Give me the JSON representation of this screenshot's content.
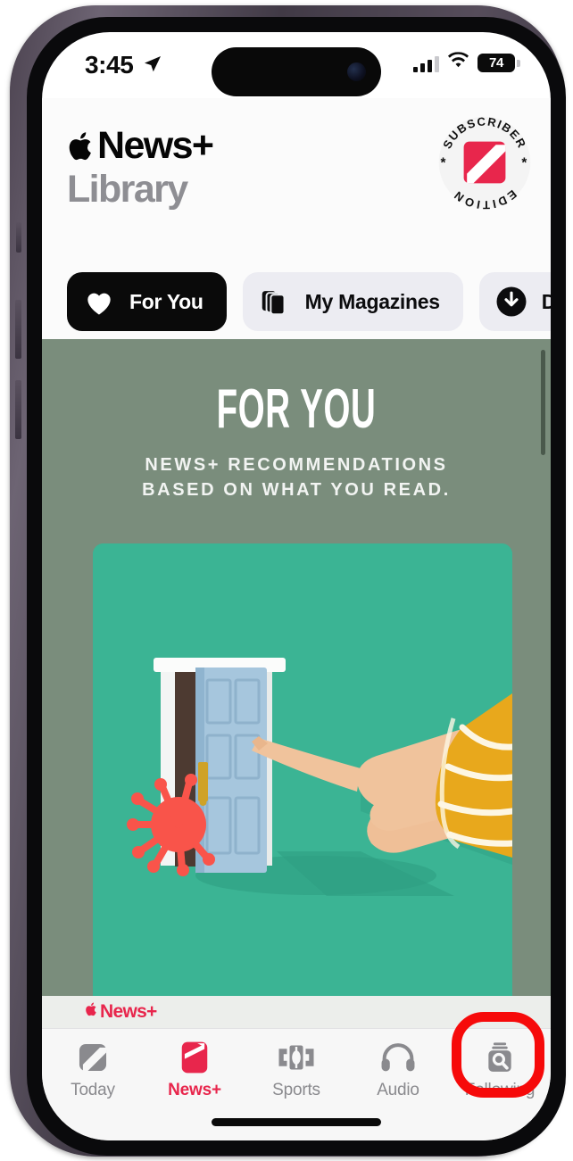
{
  "status_bar": {
    "time": "3:45",
    "location_icon": "location-arrow-icon",
    "signal_icon": "cellular-bars-icon",
    "wifi_icon": "wifi-icon",
    "battery_level": "74",
    "battery_icon": "battery-icon"
  },
  "header": {
    "apple_logo_icon": "apple-logo-icon",
    "brand": "News+",
    "section": "Library",
    "badge": {
      "top_text": "SUBSCRIBER",
      "bottom_text": "EDITION",
      "star_left": "*",
      "star_right": "*",
      "logo_icon": "news-plus-n-logo-icon",
      "logo_color": "#e8264c"
    }
  },
  "filter_pills": [
    {
      "label": "For You",
      "icon": "heart-icon",
      "active": true
    },
    {
      "label": "My Magazines",
      "icon": "magazine-stack-icon",
      "active": false
    },
    {
      "label": "Downlo",
      "icon": "download-arrow-icon",
      "active": false
    }
  ],
  "feed": {
    "title": "FOR YOU",
    "subtitle_line1": "NEWS+ RECOMMENDATIONS",
    "subtitle_line2": "BASED ON WHAT YOU READ.",
    "background_color": "#7a8d7c",
    "card": {
      "image_description": "hand-pointing-at-miniature-door-icon",
      "background_color": "#3bb494"
    },
    "footer_logo": "News+",
    "footer_logo_color": "#e8264c"
  },
  "tab_bar": [
    {
      "label": "Today",
      "icon": "news-n-icon",
      "active": false
    },
    {
      "label": "News+",
      "icon": "news-plus-icon",
      "active": true
    },
    {
      "label": "Sports",
      "icon": "sports-field-icon",
      "active": false
    },
    {
      "label": "Audio",
      "icon": "headphones-icon",
      "active": false
    },
    {
      "label": "Following",
      "icon": "following-jar-search-icon",
      "active": false
    }
  ],
  "annotation": {
    "shape": "red-rounded-circle",
    "target": "Following",
    "color": "#f60a0a"
  }
}
